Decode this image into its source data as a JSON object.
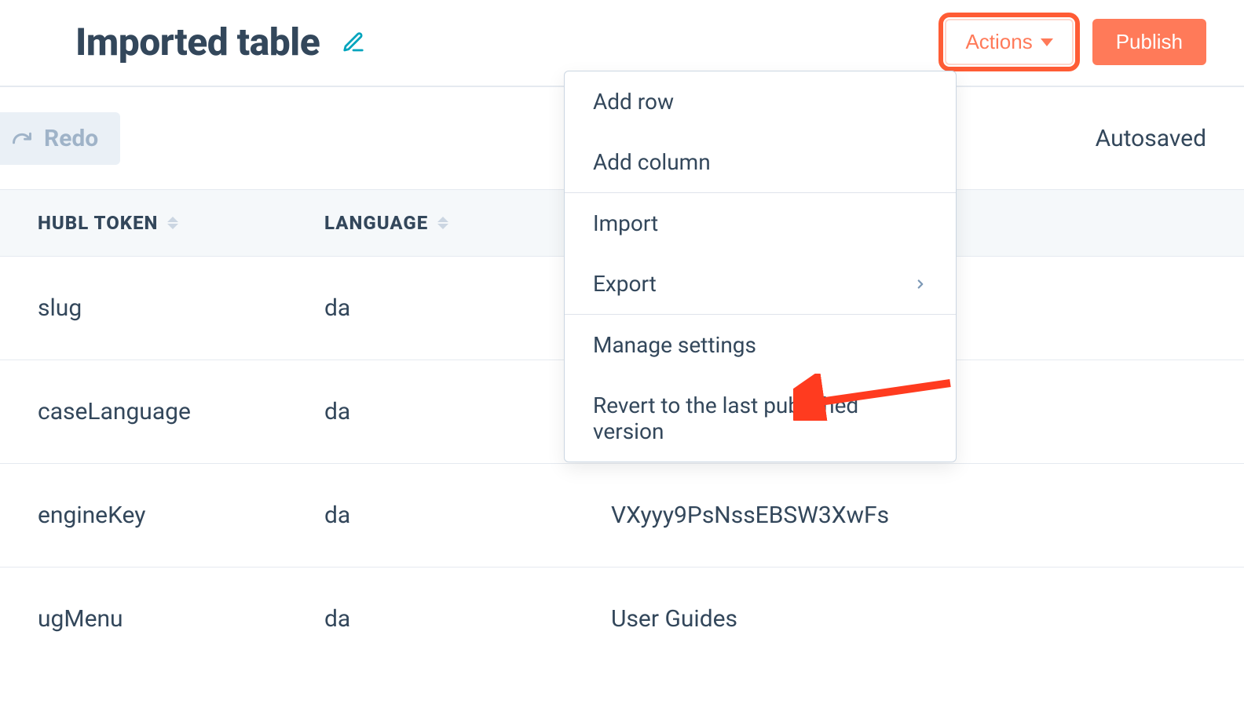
{
  "header": {
    "title": "Imported table",
    "actions_label": "Actions",
    "publish_label": "Publish"
  },
  "toolbar": {
    "redo_label": "Redo",
    "autosaved_label": "Autosaved"
  },
  "table": {
    "columns": {
      "token": "HUBL TOKEN",
      "language": "LANGUAGE"
    },
    "rows": [
      {
        "token": "slug",
        "language": "da",
        "value": ""
      },
      {
        "token": "caseLanguage",
        "language": "da",
        "value": ""
      },
      {
        "token": "engineKey",
        "language": "da",
        "value": "VXyyy9PsNssEBSW3XwFs"
      },
      {
        "token": "ugMenu",
        "language": "da",
        "value": "User Guides"
      }
    ]
  },
  "dropdown": {
    "sections": [
      {
        "items": [
          {
            "label": "Add row",
            "submenu": false
          },
          {
            "label": "Add column",
            "submenu": false
          }
        ]
      },
      {
        "items": [
          {
            "label": "Import",
            "submenu": false
          },
          {
            "label": "Export",
            "submenu": true
          }
        ]
      },
      {
        "items": [
          {
            "label": "Manage settings",
            "submenu": false
          },
          {
            "label": "Revert to the last published version",
            "submenu": false
          }
        ]
      }
    ]
  }
}
